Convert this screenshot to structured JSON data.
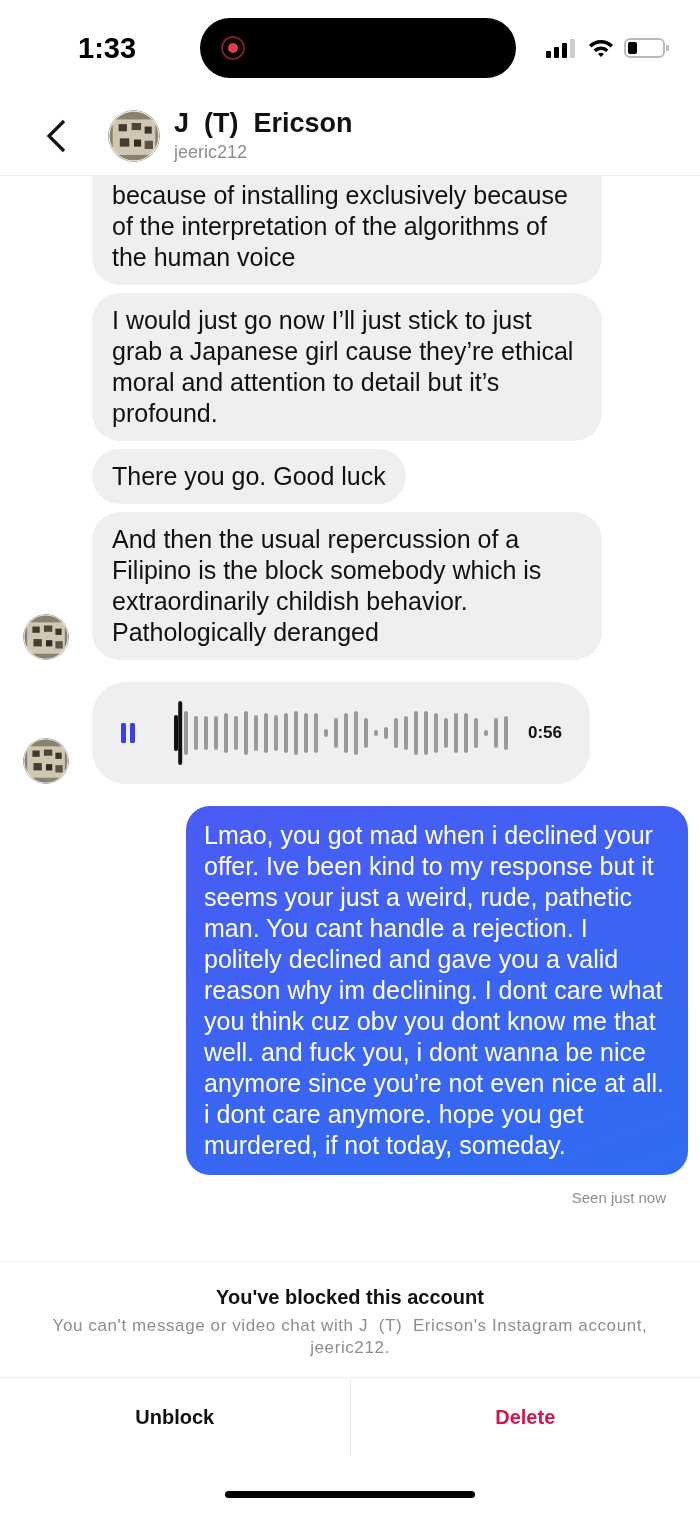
{
  "status_bar": {
    "time": "1:33",
    "recording": true
  },
  "header": {
    "name": "J  (T)  Ericson",
    "username": "jeeric212"
  },
  "messages": [
    {
      "kind": "text",
      "outgoing": false,
      "cut_top": true,
      "avatar": false,
      "text": "because of installing exclusively because of the interpretation of the algorithms of the human voice"
    },
    {
      "kind": "text",
      "outgoing": false,
      "cut_top": false,
      "avatar": false,
      "text": "I would just go now I’ll just stick to just grab a Japanese girl cause they’re ethical moral and attention to detail but it’s profound."
    },
    {
      "kind": "text",
      "outgoing": false,
      "cut_top": false,
      "avatar": false,
      "text": "There you go. Good luck"
    },
    {
      "kind": "text",
      "outgoing": false,
      "cut_top": false,
      "avatar": true,
      "text": "And then the usual repercussion of a Filipino is the block somebody which is extraordinarily childish behavior. Pathologically deranged"
    },
    {
      "kind": "voice",
      "outgoing": false,
      "avatar": true,
      "playing": true,
      "level": 0.03,
      "duration": "0:56"
    },
    {
      "kind": "text",
      "outgoing": true,
      "cut_top": false,
      "text": "Lmao, you got mad when i declined your offer. Ive been kind to my response but it seems your just a weird, rude, pathetic man. You cant handle a rejection. I politely declined and gave you a valid reason why im declining. I dont care what you think cuz obv you dont know me that well. and fuck you, i dont wanna be nice anymore since you’re not even nice at all. i dont care anymore. hope you get murdered, if not today, someday."
    }
  ],
  "seen": "Seen just now",
  "block_notice": {
    "title": "You've blocked this account",
    "text": "You can't message or video chat with J  (T)  Ericson's Instagram account, jeeric212."
  },
  "actions": [
    {
      "label": "Unblock",
      "kind": "normal"
    },
    {
      "label": "Delete",
      "kind": "destructive"
    }
  ]
}
